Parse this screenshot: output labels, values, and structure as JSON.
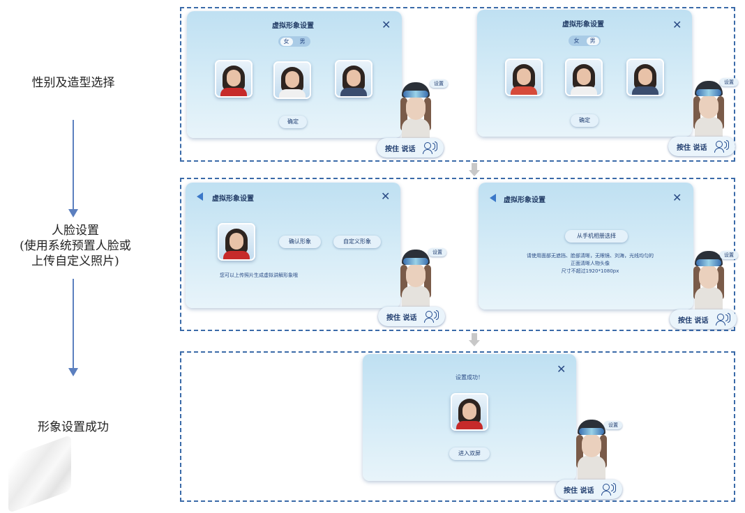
{
  "steps": [
    {
      "label": "性别及造型选择"
    },
    {
      "label_lines": [
        "人脸设置",
        "(使用系统预置人脸或",
        "上传自定义照片)"
      ]
    },
    {
      "label": "形象设置成功"
    }
  ],
  "common": {
    "panel_title": "虚拟形象设置",
    "close_glyph": "✕",
    "confirm_label": "确定",
    "setting_label": "设置",
    "talk_label": "按住 说话",
    "gender_female": "女",
    "gender_male": "男"
  },
  "face_panel": {
    "confirm_avatar_label": "确认形象",
    "custom_avatar_label": "自定义形象",
    "hint": "您可以上传照片生成虚拟讲解形象哦"
  },
  "upload_panel": {
    "album_label": "从手机相册选择",
    "instruction_line1": "请使用面部无遮挡、脸部清晰，无眼镜、刘海，光线均匀的",
    "instruction_line2": "正面清晰人物头像",
    "instruction_line3": "尺寸不超过1920*1080px"
  },
  "success_panel": {
    "message": "设置成功！",
    "enter_label": "进入双屏"
  },
  "icons": [
    "close-icon",
    "back-arrow-icon",
    "microphone-voice-icon",
    "down-arrow-icon"
  ],
  "colors": {
    "flow_arrow": "#5b7fbf",
    "section_border": "#3a6aa8",
    "panel_bg": "#cfe7f5",
    "gray_arrow": "#c8c8c8"
  }
}
